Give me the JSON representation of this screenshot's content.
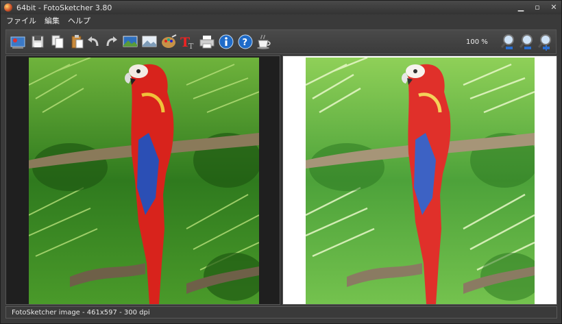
{
  "window": {
    "title": "64bit - FotoSketcher 3.80"
  },
  "menu": {
    "items": [
      "ファイル",
      "編集",
      "ヘルプ"
    ]
  },
  "toolbar": {
    "zoom_label": "100 %",
    "icons": [
      "open-picture-icon",
      "save-icon",
      "copy-icon",
      "paste-icon",
      "undo-icon",
      "redo-icon",
      "original-image-icon",
      "sketch-image-icon",
      "palette-icon",
      "text-tool-icon",
      "print-icon",
      "info-icon",
      "help-icon",
      "coffee-icon",
      "zoom-out-icon",
      "zoom-reset-icon",
      "zoom-in-icon"
    ]
  },
  "status": {
    "text": "FotoSketcher image - 461x597 - 300 dpi"
  },
  "colors": {
    "window_bg": "#3a3a3a",
    "parrot_red": "#d8231c",
    "foliage": "#3f9a2a",
    "canvas_white": "#ffffff"
  }
}
